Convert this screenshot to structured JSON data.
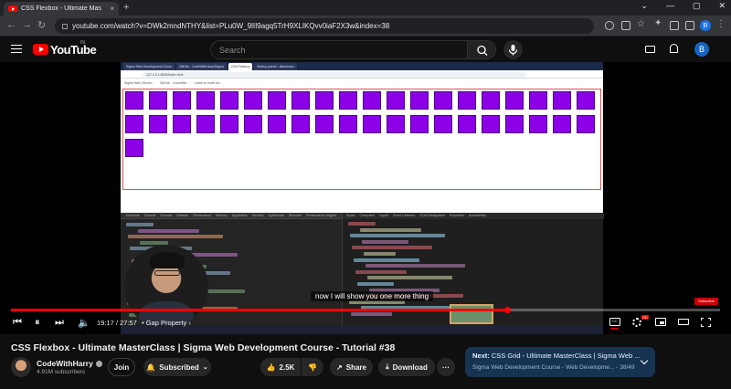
{
  "browser": {
    "tab_title": "CSS Flexbox - Ultimate Mas",
    "tab_close": "×",
    "new_tab": "+",
    "url": "youtube.com/watch?v=DWk2mndNTHY&list=PLu0W_9lII9agq5TrH9XLIKQvv0iaF2X3w&index=38",
    "window_controls": [
      "⌄",
      "—",
      "▢",
      "✕"
    ],
    "profile_letter": "B"
  },
  "youtube_header": {
    "logo_text": "YouTube",
    "region": "IN",
    "search_placeholder": "Search",
    "avatar_letter": "B"
  },
  "video_frame": {
    "inner_tabs": [
      "Sigma Web Development Cours",
      "GitHub - CodeWithHarry/Sigma",
      "CSS Flexbox",
      "Wobuy planet - dimension"
    ],
    "inner_url": "127.0.0.1:5500/index.html",
    "bookmarks": [
      "Sigma Web Develo...",
      "GitHub - CodeWith...",
      "Learn to code onl..."
    ],
    "caption": "now I will show you one more thing",
    "subscribe_badge": "Subscribe",
    "devtools_tabs": [
      "Elements",
      "Console",
      "Sources",
      "Network",
      "Performance",
      "Memory",
      "Application",
      "Security",
      "Lighthouse",
      "Recorder",
      "Performance insights"
    ],
    "devtools_right_tabs": [
      "Styles",
      "Computed",
      "Layout",
      "Event Listeners",
      "DOM Breakpoints",
      "Properties",
      "Accessibility"
    ]
  },
  "player": {
    "progress": 0.7,
    "time": "19:17 / 27:57",
    "chapter": "Gap Property",
    "hd": "HD"
  },
  "video_info": {
    "title": "CSS Flexbox - Ultimate MasterClass | Sigma Web Development Course - Tutorial #38",
    "channel": "CodeWithHarry",
    "subscribers": "4.91M subscribers",
    "join_label": "Join",
    "subscribed_label": "Subscribed",
    "likes": "2.5K",
    "share_label": "Share",
    "download_label": "Download",
    "more": "···"
  },
  "next_up": {
    "label": "Next:",
    "title": "CSS Grid - Ultimate MasterClass | Sigma Web ...",
    "playlist": "Sigma Web Development Course - Web Developme...",
    "position": "38/49"
  }
}
